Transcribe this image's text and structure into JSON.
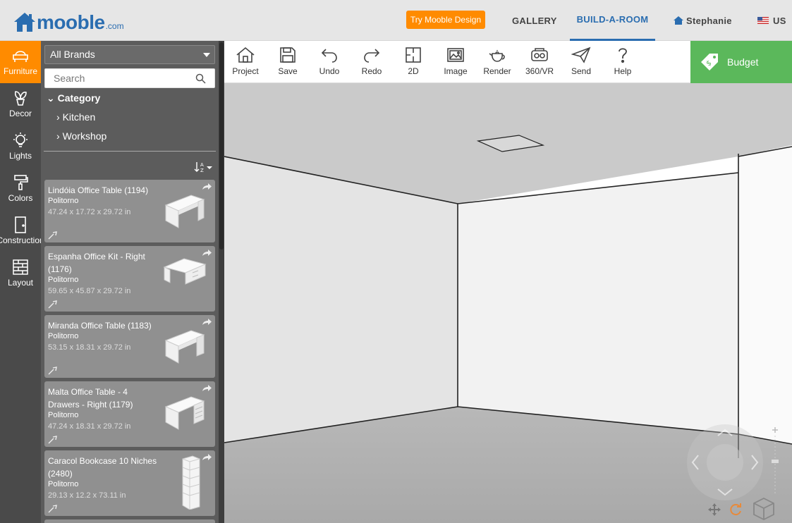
{
  "header": {
    "logo_word": "mooble",
    "logo_domain": ".com",
    "try_button": "Try Mooble Design",
    "nav_gallery": "GALLERY",
    "nav_build": "BUILD-A-ROOM",
    "user_name": "Stephanie",
    "country": "US"
  },
  "leftnav": {
    "items": [
      {
        "label": "Furniture",
        "icon": "armchair-icon",
        "active": true
      },
      {
        "label": "Decor",
        "icon": "plant-icon"
      },
      {
        "label": "Lights",
        "icon": "bulb-icon"
      },
      {
        "label": "Colors",
        "icon": "paint-roller-icon"
      },
      {
        "label": "Construction",
        "icon": "door-icon"
      },
      {
        "label": "Layout",
        "icon": "brick-wall-icon"
      }
    ]
  },
  "catalog": {
    "brand_selected": "All Brands",
    "search_placeholder": "Search",
    "category_label": "Category",
    "subcategories": [
      "Kitchen",
      "Workshop"
    ],
    "products": [
      {
        "name": "Lindóia Office Table (1194)",
        "brand": "Politorno",
        "dims": "47.24 x 17.72 x 29.72 in"
      },
      {
        "name": "Espanha Office Kit - Right (1176)",
        "brand": "Politorno",
        "dims": "59.65 x 45.87 x 29.72 in"
      },
      {
        "name": "Miranda Office Table (1183)",
        "brand": "Politorno",
        "dims": "53.15 x 18.31 x 29.72 in"
      },
      {
        "name": "Malta Office Table - 4 Drawers - Right (1179)",
        "brand": "Politorno",
        "dims": "47.24 x 18.31 x 29.72 in"
      },
      {
        "name": "Caracol Bookcase 10 Niches (2480)",
        "brand": "Politorno",
        "dims": "29.13 x 12.2 x 73.11 in"
      }
    ]
  },
  "toolbar": {
    "items": [
      "Project",
      "Save",
      "Undo",
      "Redo",
      "2D",
      "Image",
      "Render",
      "360/VR",
      "Send",
      "Help"
    ],
    "budget": "Budget"
  },
  "colors": {
    "brand_blue": "#2a6db0",
    "accent_orange": "#ff8b00",
    "budget_green": "#5bb85b",
    "panel_dark": "#4a4a4a"
  }
}
